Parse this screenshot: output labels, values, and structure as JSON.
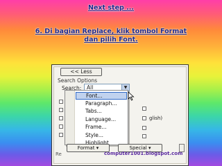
{
  "slide": {
    "title": "Next step ...",
    "instruction": "6. Di bagian Replace, klik tombol Format dan pilih Font."
  },
  "dialog": {
    "less_button": "<< Less",
    "search_options_label": "Search Options",
    "search_label": "Search:",
    "search_value": "All",
    "background_fragment": "glish)",
    "re_label": "Re"
  },
  "format_menu": {
    "items": [
      "Font...",
      "Paragraph...",
      "Tabs...",
      "Language...",
      "Frame...",
      "Style...",
      "Highlight"
    ],
    "highlighted_index": 0
  },
  "buttons": {
    "format_label": "Format ▾",
    "special_label": "Special ▾"
  },
  "watermark": "computer1001.blogspot.com",
  "colors": {
    "slide_text": "#1f2a8c",
    "menu_highlight": "#c1d2ee",
    "menu_highlight_border": "#316ac5"
  }
}
